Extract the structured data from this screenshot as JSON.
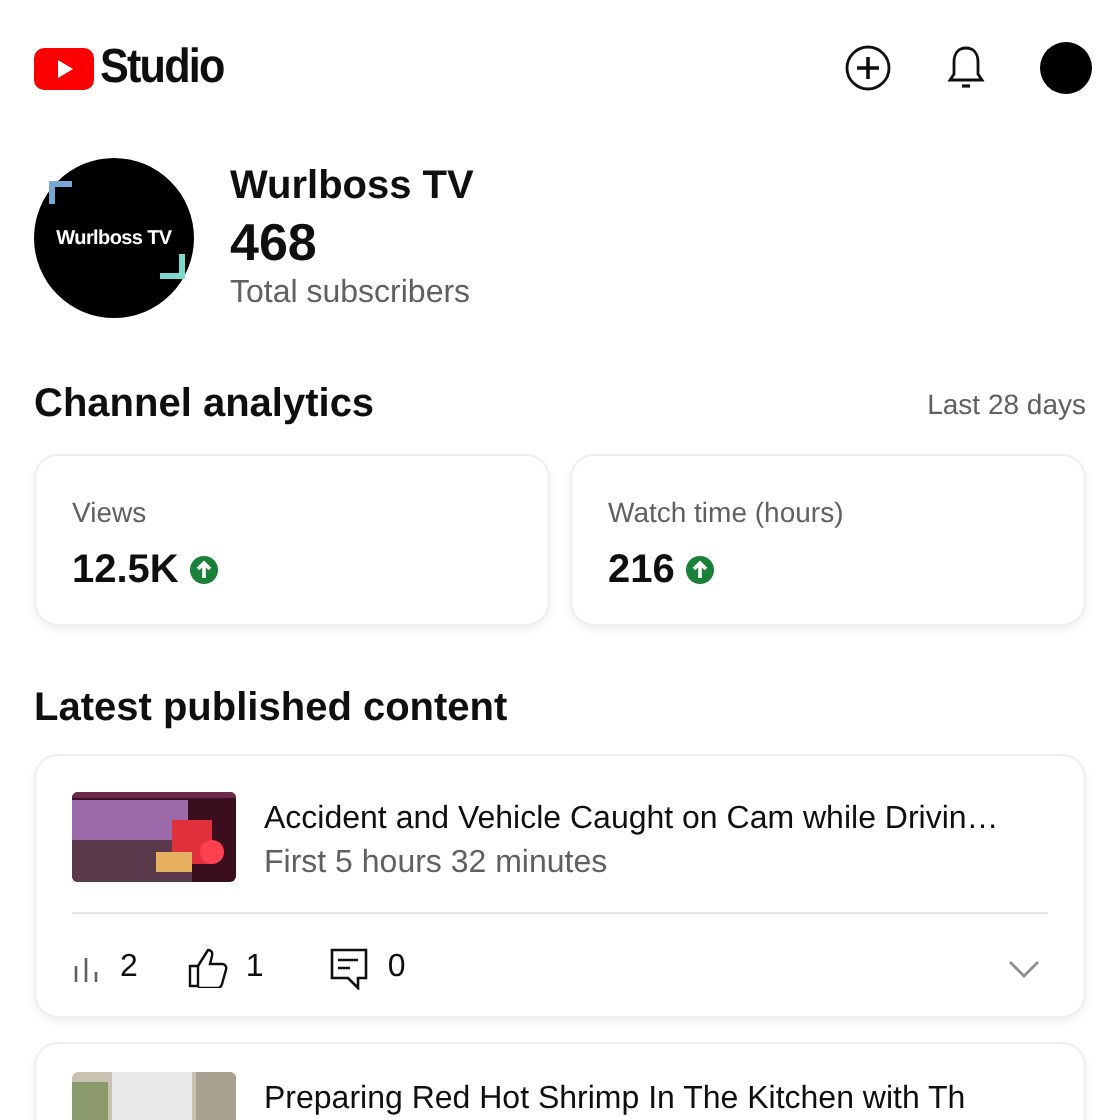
{
  "header": {
    "logo_text": "Studio"
  },
  "channel": {
    "avatar_text": "Wurlboss TV",
    "name": "Wurlboss TV",
    "subscribers": "468",
    "subscribers_label": "Total subscribers"
  },
  "analytics": {
    "title": "Channel analytics",
    "period": "Last 28 days",
    "metrics": [
      {
        "label": "Views",
        "value": "12.5K",
        "rising": true
      },
      {
        "label": "Watch time (hours)",
        "value": "216",
        "rising": true
      }
    ]
  },
  "latest": {
    "title": "Latest published content",
    "items": [
      {
        "title": "Accident and Vehicle Caught on Cam while Drivin…",
        "subtitle": "First 5 hours 32 minutes",
        "views": "2",
        "likes": "1",
        "comments": "0"
      },
      {
        "title": "Preparing Red Hot Shrimp In The Kitchen with Th"
      }
    ]
  }
}
